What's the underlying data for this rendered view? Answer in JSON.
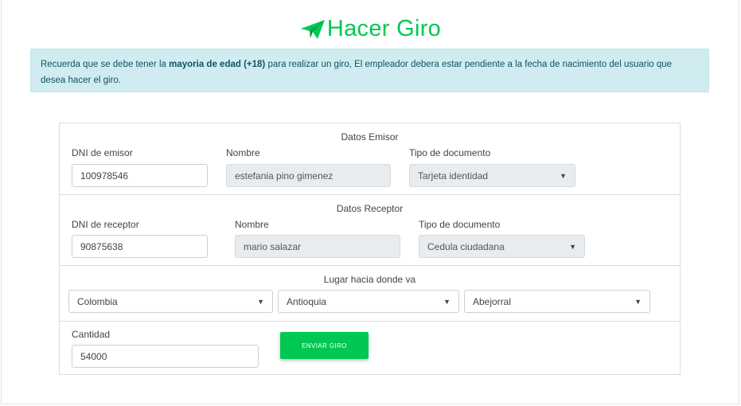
{
  "header": {
    "title": "Hacer Giro",
    "icon": "paper-plane-icon",
    "accent": "#00c853"
  },
  "alert": {
    "text_before": "Recuerda que se debe tener la ",
    "bold": "mayoria de edad (+18)",
    "text_after": " para realizar un giro, El empleador debera estar pendiente a la fecha de nacimiento del usuario que desea hacer el giro."
  },
  "emisor": {
    "section_title": "Datos Emisor",
    "dni_label": "DNI de emisor",
    "dni_value": "100978546",
    "nombre_label": "Nombre",
    "nombre_value": "estefania pino gimenez",
    "tipo_label": "Tipo de documento",
    "tipo_value": "Tarjeta identidad"
  },
  "receptor": {
    "section_title": "Datos Receptor",
    "dni_label": "DNI de receptor",
    "dni_value": "90875638",
    "nombre_label": "Nombre",
    "nombre_value": "mario salazar",
    "tipo_label": "Tipo de documento",
    "tipo_value": "Cedula ciudadana"
  },
  "lugar": {
    "section_title": "Lugar hacia donde va",
    "pais": "Colombia",
    "departamento": "Antioquia",
    "municipio": "Abejorral"
  },
  "cantidad": {
    "label": "Cantidad",
    "value": "54000",
    "submit_label": "ENVIAR GIRO"
  }
}
